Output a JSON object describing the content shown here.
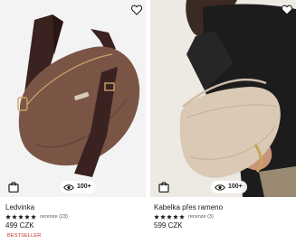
{
  "products": [
    {
      "name": "Ledvinka",
      "rating": 5,
      "reviews_text": "recenze (23)",
      "price": "499 CZK",
      "badge": "BESTSELLER",
      "views": "100+",
      "image_icon": "brown-belt-bag-photo"
    },
    {
      "name": "Kabelka přes rameno",
      "rating": 5,
      "reviews_text": "recenze (3)",
      "price": "599 CZK",
      "views": "100+",
      "image_icon": "beige-shoulder-bag-photo"
    }
  ],
  "colors": {
    "badge": "#c62828",
    "text": "#1a1a1a",
    "belt_bag": "#7a5546",
    "strap": "#3a2220",
    "shoulder_bag": "#d9c9b5",
    "jacket": "#1c1c1c"
  },
  "icons": [
    "heart-outline-icon",
    "shopping-bag-icon",
    "eye-icon",
    "star-icon"
  ]
}
